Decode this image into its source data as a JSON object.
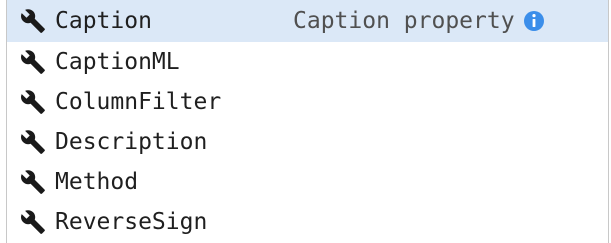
{
  "suggestions": [
    {
      "label": "Caption",
      "icon": "wrench-icon",
      "selected": true,
      "detail": "Caption property"
    },
    {
      "label": "CaptionML",
      "icon": "wrench-icon",
      "selected": false
    },
    {
      "label": "ColumnFilter",
      "icon": "wrench-icon",
      "selected": false
    },
    {
      "label": "Description",
      "icon": "wrench-icon",
      "selected": false
    },
    {
      "label": "Method",
      "icon": "wrench-icon",
      "selected": false
    },
    {
      "label": "ReverseSign",
      "icon": "wrench-icon",
      "selected": false
    }
  ],
  "colors": {
    "selected_background": "#dbe8f7",
    "info_icon": "#3b8eea",
    "text": "#1f1f1f"
  }
}
